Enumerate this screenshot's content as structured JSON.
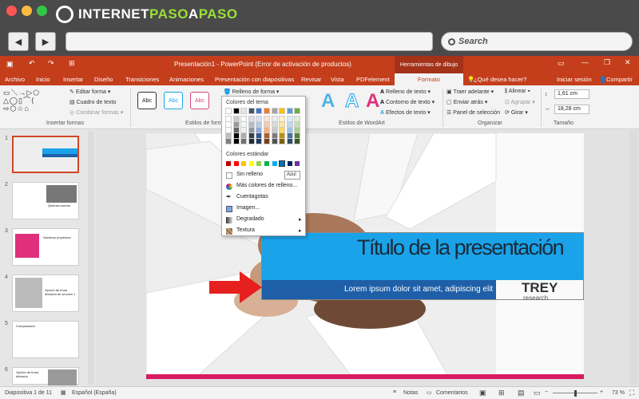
{
  "site": {
    "logo_pre": "INTERNET",
    "logo_accent": "PASO",
    "logo_a": "A",
    "logo_post": "PASO"
  },
  "browser": {
    "search_label": "Search"
  },
  "app": {
    "title": "Presentación1 - PowerPoint (Error de activación de productos)",
    "context_tab": "Herramientas de dibujo"
  },
  "tabs": [
    "Archivo",
    "Inicio",
    "Insertar",
    "Diseño",
    "Transiciones",
    "Animaciones",
    "Presentación con diapositivas",
    "Revisar",
    "Vista",
    "PDFelement",
    "Formato"
  ],
  "tell_me": "¿Qué desea hacer?",
  "signin": "Iniciar sesión",
  "share": "Compartir",
  "ribbon": {
    "insert_shapes": {
      "edit_shape": "Editar forma",
      "text_box": "Cuadro de texto",
      "merge_shapes": "Combinar formas",
      "label": "Insertar formas"
    },
    "shape_styles": {
      "style_sample": "Abc",
      "fill_button": "Relleno de forma",
      "label": "Estilos de forma"
    },
    "wordart": {
      "sample": "A",
      "text_fill": "Relleno de texto",
      "text_outline": "Contorno de texto",
      "text_effects": "Efectos de texto",
      "label": "Estilos de WordArt"
    },
    "arrange": {
      "bring_forward": "Traer adelante",
      "send_backward": "Enviar atrás",
      "selection_pane": "Panel de selección",
      "align": "Alinear",
      "group": "Agrupar",
      "rotate": "Girar",
      "label": "Organizar"
    },
    "size": {
      "height": "1,61 cm",
      "width": "18,28 cm",
      "label": "Tamaño"
    }
  },
  "dropdown": {
    "theme_colors_label": "Colores del tema",
    "standard_colors_label": "Colores estándar",
    "tooltip": "Azul",
    "items": [
      {
        "label": "Sin relleno",
        "icon": "no-fill-icon"
      },
      {
        "label": "Más colores de relleno...",
        "icon": "color-wheel-icon"
      },
      {
        "label": "Cuentagotas",
        "icon": "eyedropper-icon"
      },
      {
        "label": "Imagen...",
        "icon": "image-icon"
      },
      {
        "label": "Degradado",
        "icon": "gradient-icon",
        "submenu": true
      },
      {
        "label": "Textura",
        "icon": "texture-icon",
        "submenu": true
      }
    ]
  },
  "slides": {
    "numbers": [
      "1",
      "2",
      "3",
      "4",
      "5",
      "6"
    ],
    "thumb_texts": [
      "",
      "Quiénes somos",
      "Nuestros proyectos",
      "Opción de línea divisoria de sección 1",
      "Comparación",
      "Opción de línea divisoria"
    ]
  },
  "slide": {
    "title": "Título de la presentación",
    "subtitle": "Lorem ipsum dolor sit amet, adipiscing elit",
    "brand": "TREY",
    "brand_sub": "research"
  },
  "status": {
    "slide_count": "Diapositiva 1 de 11",
    "language": "Español (España)",
    "notes": "Notas",
    "comments": "Comentarios",
    "zoom": "73 %"
  },
  "colors": {
    "accent": "#c43e1c",
    "slide_blue": "#1aa3e8",
    "slide_dark_blue": "#1e5fa8"
  }
}
